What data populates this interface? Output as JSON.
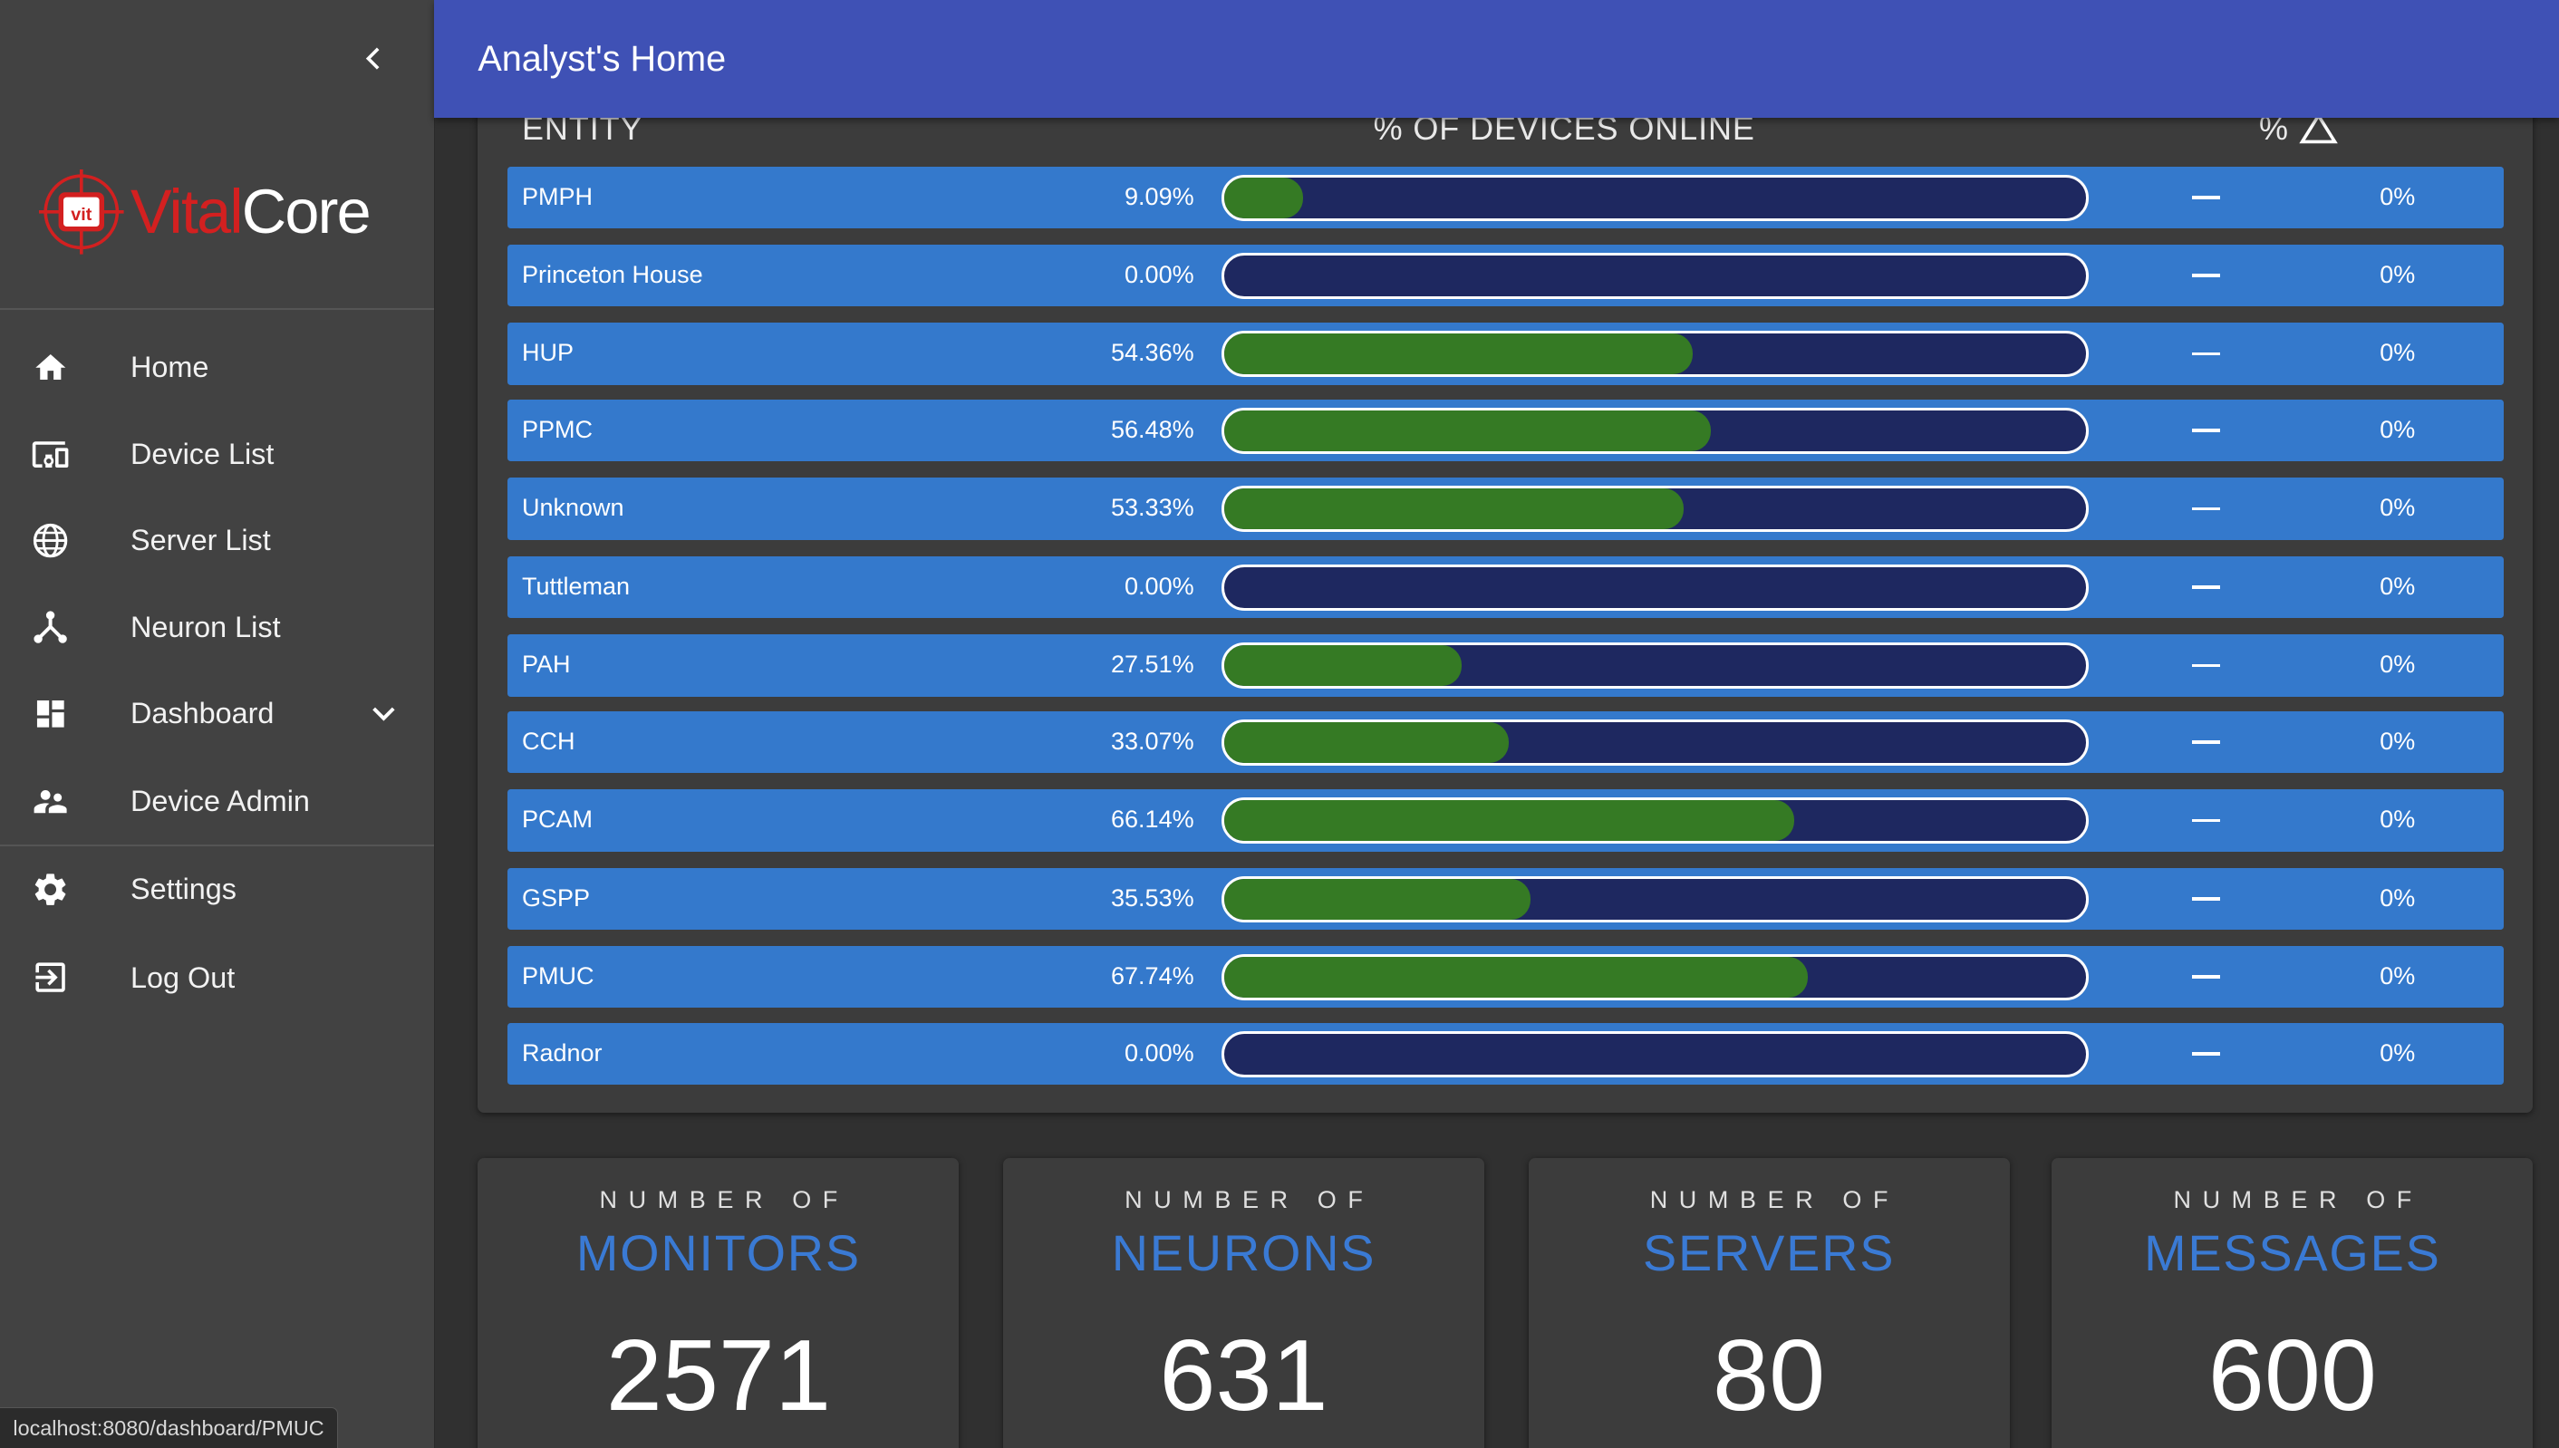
{
  "header": {
    "title": "Analyst's Home"
  },
  "brand": {
    "part1": "Vital",
    "part2": "Core",
    "mark_text": "vit"
  },
  "sidebar": {
    "items": [
      {
        "label": "Home",
        "icon": "home-icon"
      },
      {
        "label": "Device List",
        "icon": "devices-icon"
      },
      {
        "label": "Server List",
        "icon": "globe-icon"
      },
      {
        "label": "Neuron List",
        "icon": "network-icon"
      },
      {
        "label": "Dashboard",
        "icon": "dashboard-icon"
      },
      {
        "label": "Device Admin",
        "icon": "people-icon"
      },
      {
        "label": "Settings",
        "icon": "gear-icon"
      },
      {
        "label": "Log Out",
        "icon": "logout-icon"
      }
    ]
  },
  "table": {
    "headers": {
      "entity": "ENTITY",
      "online": "% OF DEVICES ONLINE",
      "change": "%"
    },
    "rows": [
      {
        "entity": "PMPH",
        "pct_text": "9.09%",
        "fill": 0.0909,
        "change": "0%"
      },
      {
        "entity": "Princeton House",
        "pct_text": "0.00%",
        "fill": 0.0,
        "change": "0%"
      },
      {
        "entity": "HUP",
        "pct_text": "54.36%",
        "fill": 0.5436,
        "change": "0%"
      },
      {
        "entity": "PPMC",
        "pct_text": "56.48%",
        "fill": 0.5648,
        "change": "0%"
      },
      {
        "entity": "Unknown",
        "pct_text": "53.33%",
        "fill": 0.5333,
        "change": "0%"
      },
      {
        "entity": "Tuttleman",
        "pct_text": "0.00%",
        "fill": 0.0,
        "change": "0%"
      },
      {
        "entity": "PAH",
        "pct_text": "27.51%",
        "fill": 0.2751,
        "change": "0%"
      },
      {
        "entity": "CCH",
        "pct_text": "33.07%",
        "fill": 0.3307,
        "change": "0%"
      },
      {
        "entity": "PCAM",
        "pct_text": "66.14%",
        "fill": 0.6614,
        "change": "0%"
      },
      {
        "entity": "GSPP",
        "pct_text": "35.53%",
        "fill": 0.3553,
        "change": "0%"
      },
      {
        "entity": "PMUC",
        "pct_text": "67.74%",
        "fill": 0.6774,
        "change": "0%"
      },
      {
        "entity": "Radnor",
        "pct_text": "0.00%",
        "fill": 0.0,
        "change": "0%"
      }
    ]
  },
  "stats": [
    {
      "prefix": "NUMBER OF",
      "label": "MONITORS",
      "value": "2571"
    },
    {
      "prefix": "NUMBER OF",
      "label": "NEURONS",
      "value": "631"
    },
    {
      "prefix": "NUMBER OF",
      "label": "SERVERS",
      "value": "80"
    },
    {
      "prefix": "NUMBER OF",
      "label": "MESSAGES",
      "value": "600"
    }
  ],
  "status_url": "localhost:8080/dashboard/PMUC",
  "colors": {
    "header": "#3f51b5",
    "sidebar": "#424242",
    "row": "#3479cc",
    "bar_track": "#1e2860",
    "bar_fill": "#357a24",
    "stat_label": "#3a7ad4",
    "brand_red": "#d32020"
  }
}
